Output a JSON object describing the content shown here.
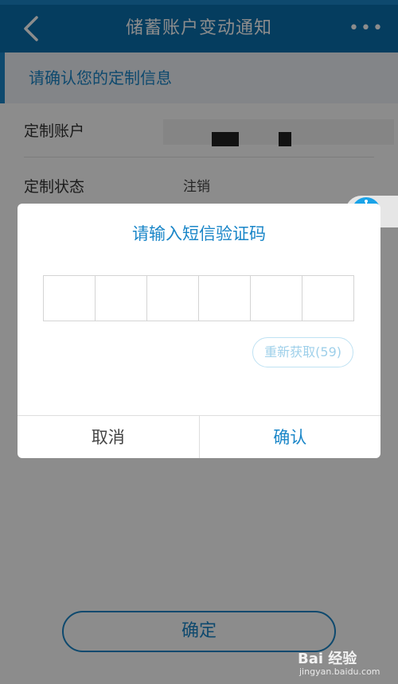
{
  "nav": {
    "title": "储蓄账户变动通知",
    "back_icon": "chevron-left-icon",
    "more_icon": "more-dots-icon",
    "more_glyph": "•••"
  },
  "section": {
    "header": "请确认您的定制信息"
  },
  "info_rows": [
    {
      "label": "定制账户",
      "value": ""
    },
    {
      "label": "定制状态",
      "value": "注销"
    }
  ],
  "main": {
    "confirm_label": "确定"
  },
  "dialog": {
    "title": "请输入短信验证码",
    "code_length": 6,
    "resend_label": "重新获取(59)",
    "cancel_label": "取消",
    "ok_label": "确认"
  },
  "watermark": {
    "brand": "Bai 经验",
    "domain": "jingyan.baidu.com"
  },
  "colors": {
    "accent": "#1a86c8",
    "nav_bg": "#0a6fae",
    "robot": "#1aa3e8"
  }
}
